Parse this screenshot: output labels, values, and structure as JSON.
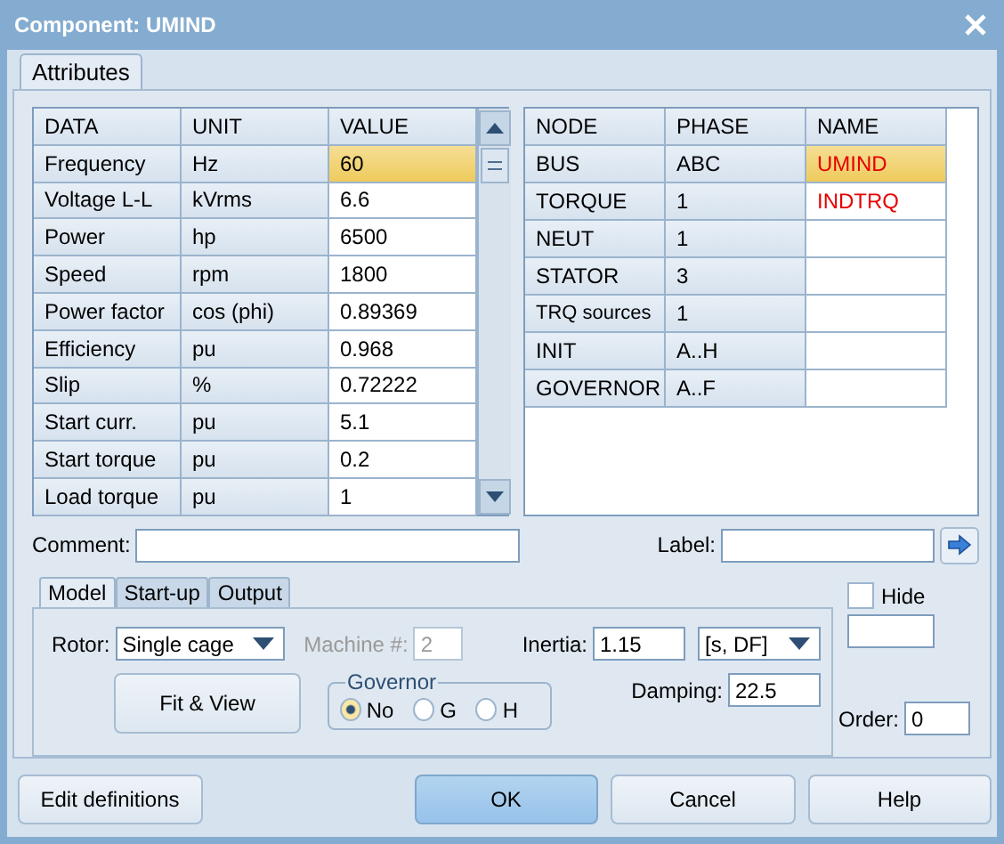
{
  "window": {
    "title": "Component: UMIND"
  },
  "tabs": [
    {
      "label": "Attributes",
      "selected": true
    }
  ],
  "data_table": {
    "columns": [
      "DATA",
      "UNIT",
      "VALUE"
    ],
    "rows": [
      {
        "data": "Frequency",
        "unit": "Hz",
        "value": "60",
        "selected": true
      },
      {
        "data": "Voltage L-L",
        "unit": "kVrms",
        "value": "6.6",
        "selected": false
      },
      {
        "data": "Power",
        "unit": "hp",
        "value": "6500",
        "selected": false
      },
      {
        "data": "Speed",
        "unit": "rpm",
        "value": "1800",
        "selected": false
      },
      {
        "data": "Power factor",
        "unit": "cos (phi)",
        "value": "0.89369",
        "selected": false
      },
      {
        "data": "Efficiency",
        "unit": "pu",
        "value": "0.968",
        "selected": false
      },
      {
        "data": "Slip",
        "unit": "%",
        "value": "0.72222",
        "selected": false
      },
      {
        "data": "Start curr.",
        "unit": "pu",
        "value": "5.1",
        "selected": false
      },
      {
        "data": "Start torque",
        "unit": "pu",
        "value": "0.2",
        "selected": false
      },
      {
        "data": "Load torque",
        "unit": "pu",
        "value": "1",
        "selected": false
      }
    ]
  },
  "node_table": {
    "columns": [
      "NODE",
      "PHASE",
      "NAME"
    ],
    "rows": [
      {
        "node": "BUS",
        "phase": "ABC",
        "name": "UMIND",
        "selected": true
      },
      {
        "node": "TORQUE",
        "phase": "1",
        "name": "INDTRQ",
        "selected": false
      },
      {
        "node": "NEUT",
        "phase": "1",
        "selected": false
      },
      {
        "node": "STATOR",
        "phase": "3",
        "selected": false
      },
      {
        "node": "TRQ sources",
        "phase": "1",
        "selected": false
      },
      {
        "node": "INIT",
        "phase": "A..H",
        "selected": false
      },
      {
        "node": "GOVERNOR",
        "phase": "A..F",
        "selected": false
      }
    ]
  },
  "comment": {
    "label": "Comment:"
  },
  "label_field": {
    "label": "Label:"
  },
  "model_tabs": [
    {
      "label": "Model",
      "selected": true
    },
    {
      "label": "Start-up",
      "selected": false
    },
    {
      "label": "Output",
      "selected": false
    }
  ],
  "rotor": {
    "label": "Rotor:",
    "value": "Single cage"
  },
  "machine": {
    "label": "Machine #:",
    "value": "2",
    "disabled": true
  },
  "inertia": {
    "label": "Inertia:",
    "value": "1.15",
    "unit": "[s, DF]"
  },
  "damping": {
    "label": "Damping:",
    "value": "22.5"
  },
  "fit_button": {
    "label": "Fit & View"
  },
  "governor": {
    "title": "Governor",
    "options": [
      {
        "label": "No",
        "selected": true
      },
      {
        "label": "G",
        "selected": false
      },
      {
        "label": "H",
        "selected": false
      }
    ]
  },
  "hide": {
    "label": "Hide",
    "checked": false
  },
  "order": {
    "label": "Order:",
    "value": "0"
  },
  "buttons": [
    {
      "label": "Edit definitions",
      "default": false
    },
    {
      "label": "OK",
      "default": true
    },
    {
      "label": "Cancel",
      "default": false
    },
    {
      "label": "Help",
      "default": false
    }
  ]
}
